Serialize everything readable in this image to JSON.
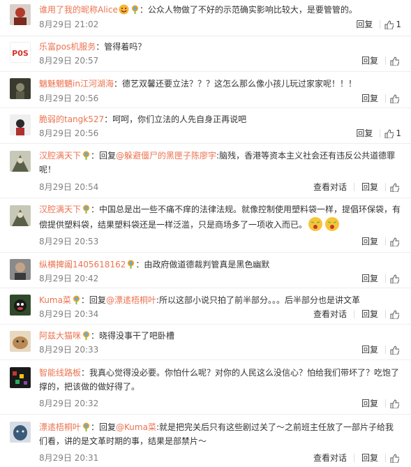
{
  "comments": [
    {
      "user": "谁用了我的昵称Alice",
      "vip": true,
      "emoji_after_name": true,
      "text": "：公众人物做了不好的示范确实影响比较大，是要管管的。",
      "time": "8月29日 21:02",
      "reply": "回复",
      "likes": "1",
      "avatar_color": "#b33a2a"
    },
    {
      "user": "乐富pos机服务",
      "vip": false,
      "text": "：管得着吗？",
      "time": "8月29日 20:57",
      "reply": "回复",
      "likes": "",
      "avatar_color": "#ffffff"
    },
    {
      "user": "魑魅魍魉in江河湖海",
      "vip": false,
      "text": "：德艺双馨还要立法？？？这怎么那么像小孩儿玩过家家呢！！！",
      "time": "8月29日 20:56",
      "reply": "回复",
      "likes": "",
      "avatar_color": "#3a3a2e"
    },
    {
      "user": "脆弱的tangk527",
      "vip": false,
      "text": "：呵呵，你们立法的人先自身正再说吧",
      "time": "8月29日 20:56",
      "reply": "回复",
      "likes": "1",
      "avatar_color": "#e8e8e8"
    },
    {
      "user": "汉腔满天下",
      "vip": true,
      "reply_prefix": "：回复",
      "mention": "@躲避僵尸的黑匣子陈廖宇",
      "text": ":脑残，香港等资本主义社会还有违反公共道德罪呢！",
      "time": "8月29日 20:54",
      "view_convo": "查看对话",
      "reply": "回复",
      "likes": "",
      "avatar_color": "#5a6048"
    },
    {
      "user": "汉腔满天下",
      "vip": true,
      "text": "：中国总是出一些不痛不痒的法律法规。就像控制使用塑料袋一样，提倡环保袋，有偿提供塑料袋，结果塑料袋还是一样泛滥，只是商场多了一项收入而已。",
      "time": "8月29日 20:53",
      "reply": "回复",
      "likes": "",
      "avatar_color": "#5a6048"
    },
    {
      "user": "纵横捭阖1405618162",
      "vip": true,
      "text": "：由政府做道德裁判管真是黑色幽默",
      "time": "8月29日 20:42",
      "reply": "回复",
      "likes": "",
      "avatar_color": "#6a6a6a"
    },
    {
      "user": "Kuma菜",
      "vip": true,
      "reply_prefix": "：回复",
      "mention": "@漂逺梧桐叶",
      "text": ":所以这部小说只拍了前半部分。。。后半部分也是讲文革",
      "time": "8月29日 20:34",
      "view_convo": "查看对话",
      "reply": "回复",
      "likes": "",
      "avatar_color": "#2f4a2a"
    },
    {
      "user": "阿兹大猫咪",
      "vip": true,
      "text": "：晓得没事干了吧卧槽",
      "time": "8月29日 20:33",
      "reply": "回复",
      "likes": "",
      "avatar_color": "#b88a55"
    },
    {
      "user": "智能线路板",
      "vip": false,
      "text": "：我真心觉得没必要。你怕什么呢？对你的人民这么没信心？怕给我们带坏了？吃饱了撑的，把该做的做好得了。",
      "time": "8月29日 20:32",
      "reply": "回复",
      "likes": "",
      "avatar_color": "#1a1a1a"
    },
    {
      "user": "漂逺梧桐叶",
      "vip": true,
      "reply_prefix": "：回复",
      "mention": "@Kuma菜",
      "text": ":就是把完关后只有这些剧过关了～之前班主任放了一部片子给我们看，讲的是文革时期的事，结果是部禁片～",
      "time": "8月29日 20:31",
      "view_convo": "查看对话",
      "reply": "回复",
      "likes": "",
      "avatar_color": "#3a5a7a"
    }
  ]
}
